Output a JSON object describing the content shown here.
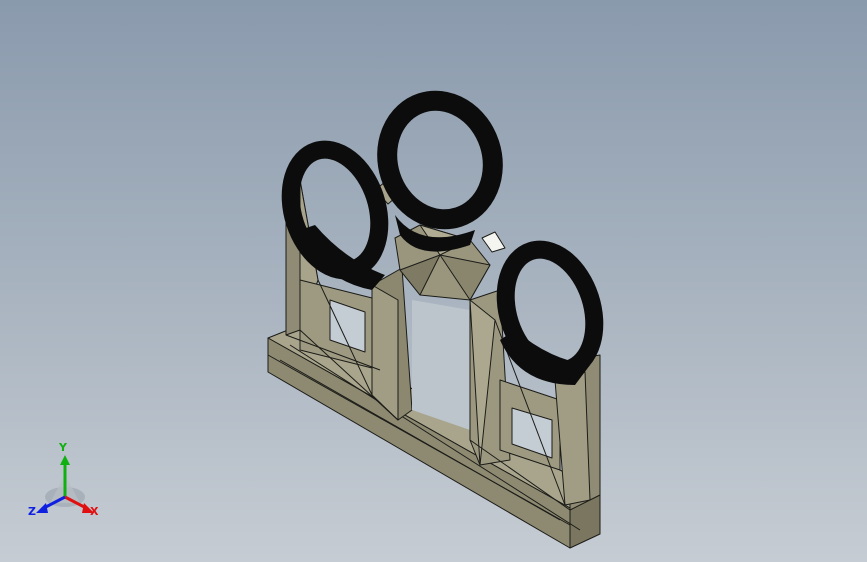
{
  "triad": {
    "x_label": "X",
    "y_label": "Y",
    "z_label": "Z",
    "colors": {
      "x": "#e01010",
      "y": "#10b010",
      "z": "#1020e0"
    }
  },
  "model": {
    "body_color": "#9a967e",
    "dark_face_color": "#6e6a56",
    "light_face_color": "#b8b49c",
    "edge_color": "#1c1c18",
    "ring_color": "#0c0c0c"
  }
}
